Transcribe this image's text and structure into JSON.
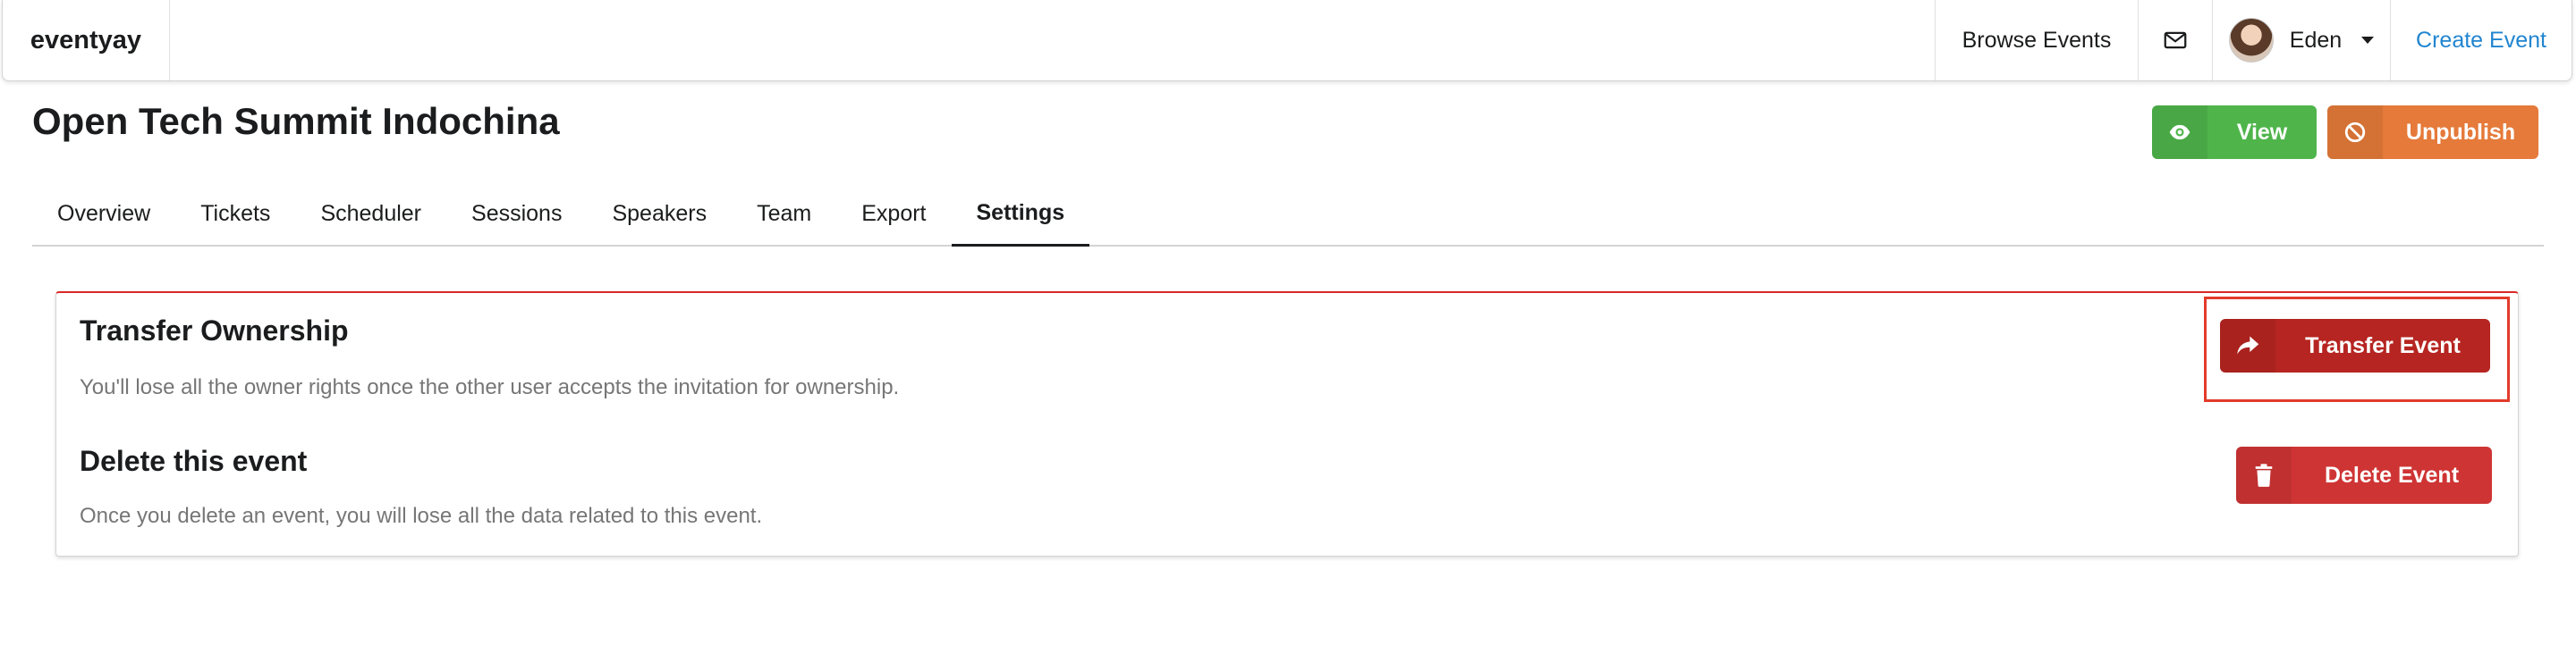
{
  "navbar": {
    "brand": "eventyay",
    "browse_events": "Browse Events",
    "mail_icon": "envelope-icon",
    "user_name": "Eden",
    "create_event": "Create Event"
  },
  "header": {
    "event_title": "Open Tech Summit Indochina",
    "view_label": "View",
    "unpublish_label": "Unpublish"
  },
  "tabs": [
    "Overview",
    "Tickets",
    "Scheduler",
    "Sessions",
    "Speakers",
    "Team",
    "Export",
    "Settings"
  ],
  "active_tab": "Settings",
  "danger_zone": {
    "transfer": {
      "title": "Transfer Ownership",
      "description": "You'll lose all the owner rights once the other user accepts the invitation for ownership.",
      "button_label": "Transfer Event"
    },
    "delete": {
      "title": "Delete this event",
      "description": "Once you delete an event, you will lose all the data related to this event.",
      "button_label": "Delete Event"
    }
  },
  "colors": {
    "view": "#4fb54b",
    "unpublish": "#e57a3a",
    "transfer": "#b62521",
    "delete": "#cf3434",
    "link": "#2185d0",
    "highlight": "#e23b2c"
  }
}
